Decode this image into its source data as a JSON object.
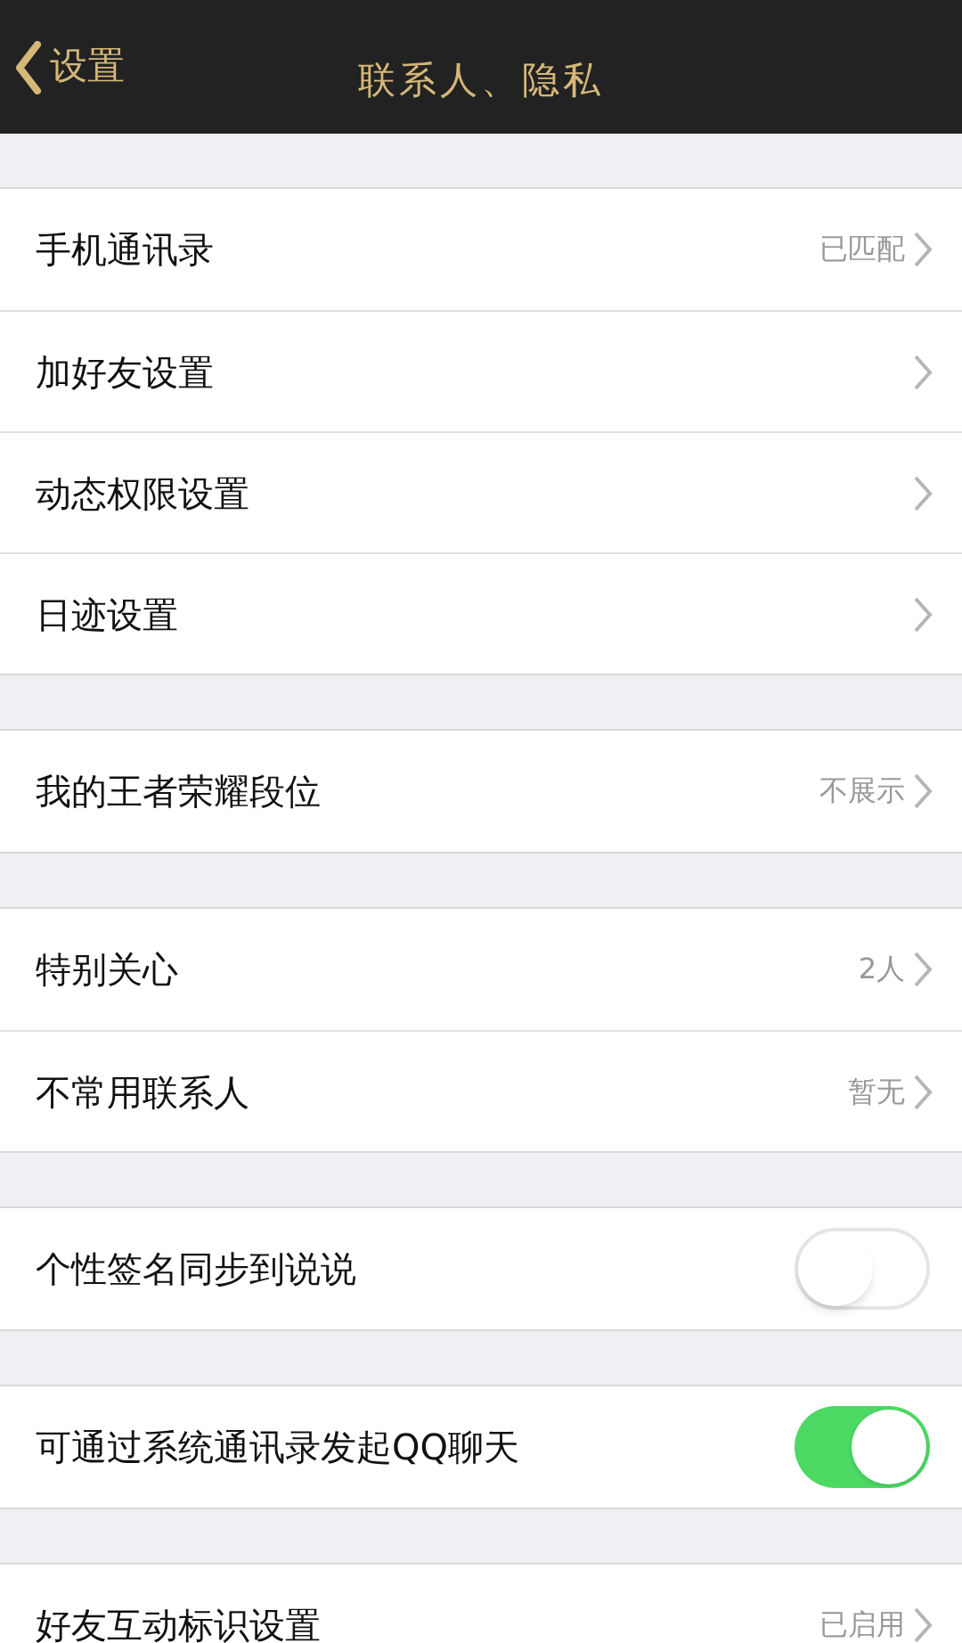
{
  "nav_bar": {
    "back_label": "设置",
    "title": "联系人、隐私"
  },
  "groups": [
    {
      "rows": [
        {
          "kind": "link",
          "label": "手机通讯录",
          "value": "已匹配"
        },
        {
          "kind": "link",
          "label": "加好友设置"
        },
        {
          "kind": "link",
          "label": "动态权限设置"
        },
        {
          "kind": "link",
          "label": "日迹设置"
        }
      ]
    },
    {
      "rows": [
        {
          "kind": "link",
          "label": "我的王者荣耀段位",
          "value": "不展示"
        }
      ]
    },
    {
      "rows": [
        {
          "kind": "link",
          "label": "特别关心",
          "value": "2人"
        },
        {
          "kind": "link",
          "label": "不常用联系人",
          "value": "暂无"
        }
      ]
    },
    {
      "rows": [
        {
          "kind": "toggle",
          "label": "个性签名同步到说说",
          "on": false
        }
      ]
    },
    {
      "rows": [
        {
          "kind": "toggle",
          "label": "可通过系统通讯录发起QQ聊天",
          "on": true
        }
      ]
    },
    {
      "rows": [
        {
          "kind": "link",
          "label": "好友互动标识设置",
          "value": "已启用"
        }
      ]
    }
  ]
}
